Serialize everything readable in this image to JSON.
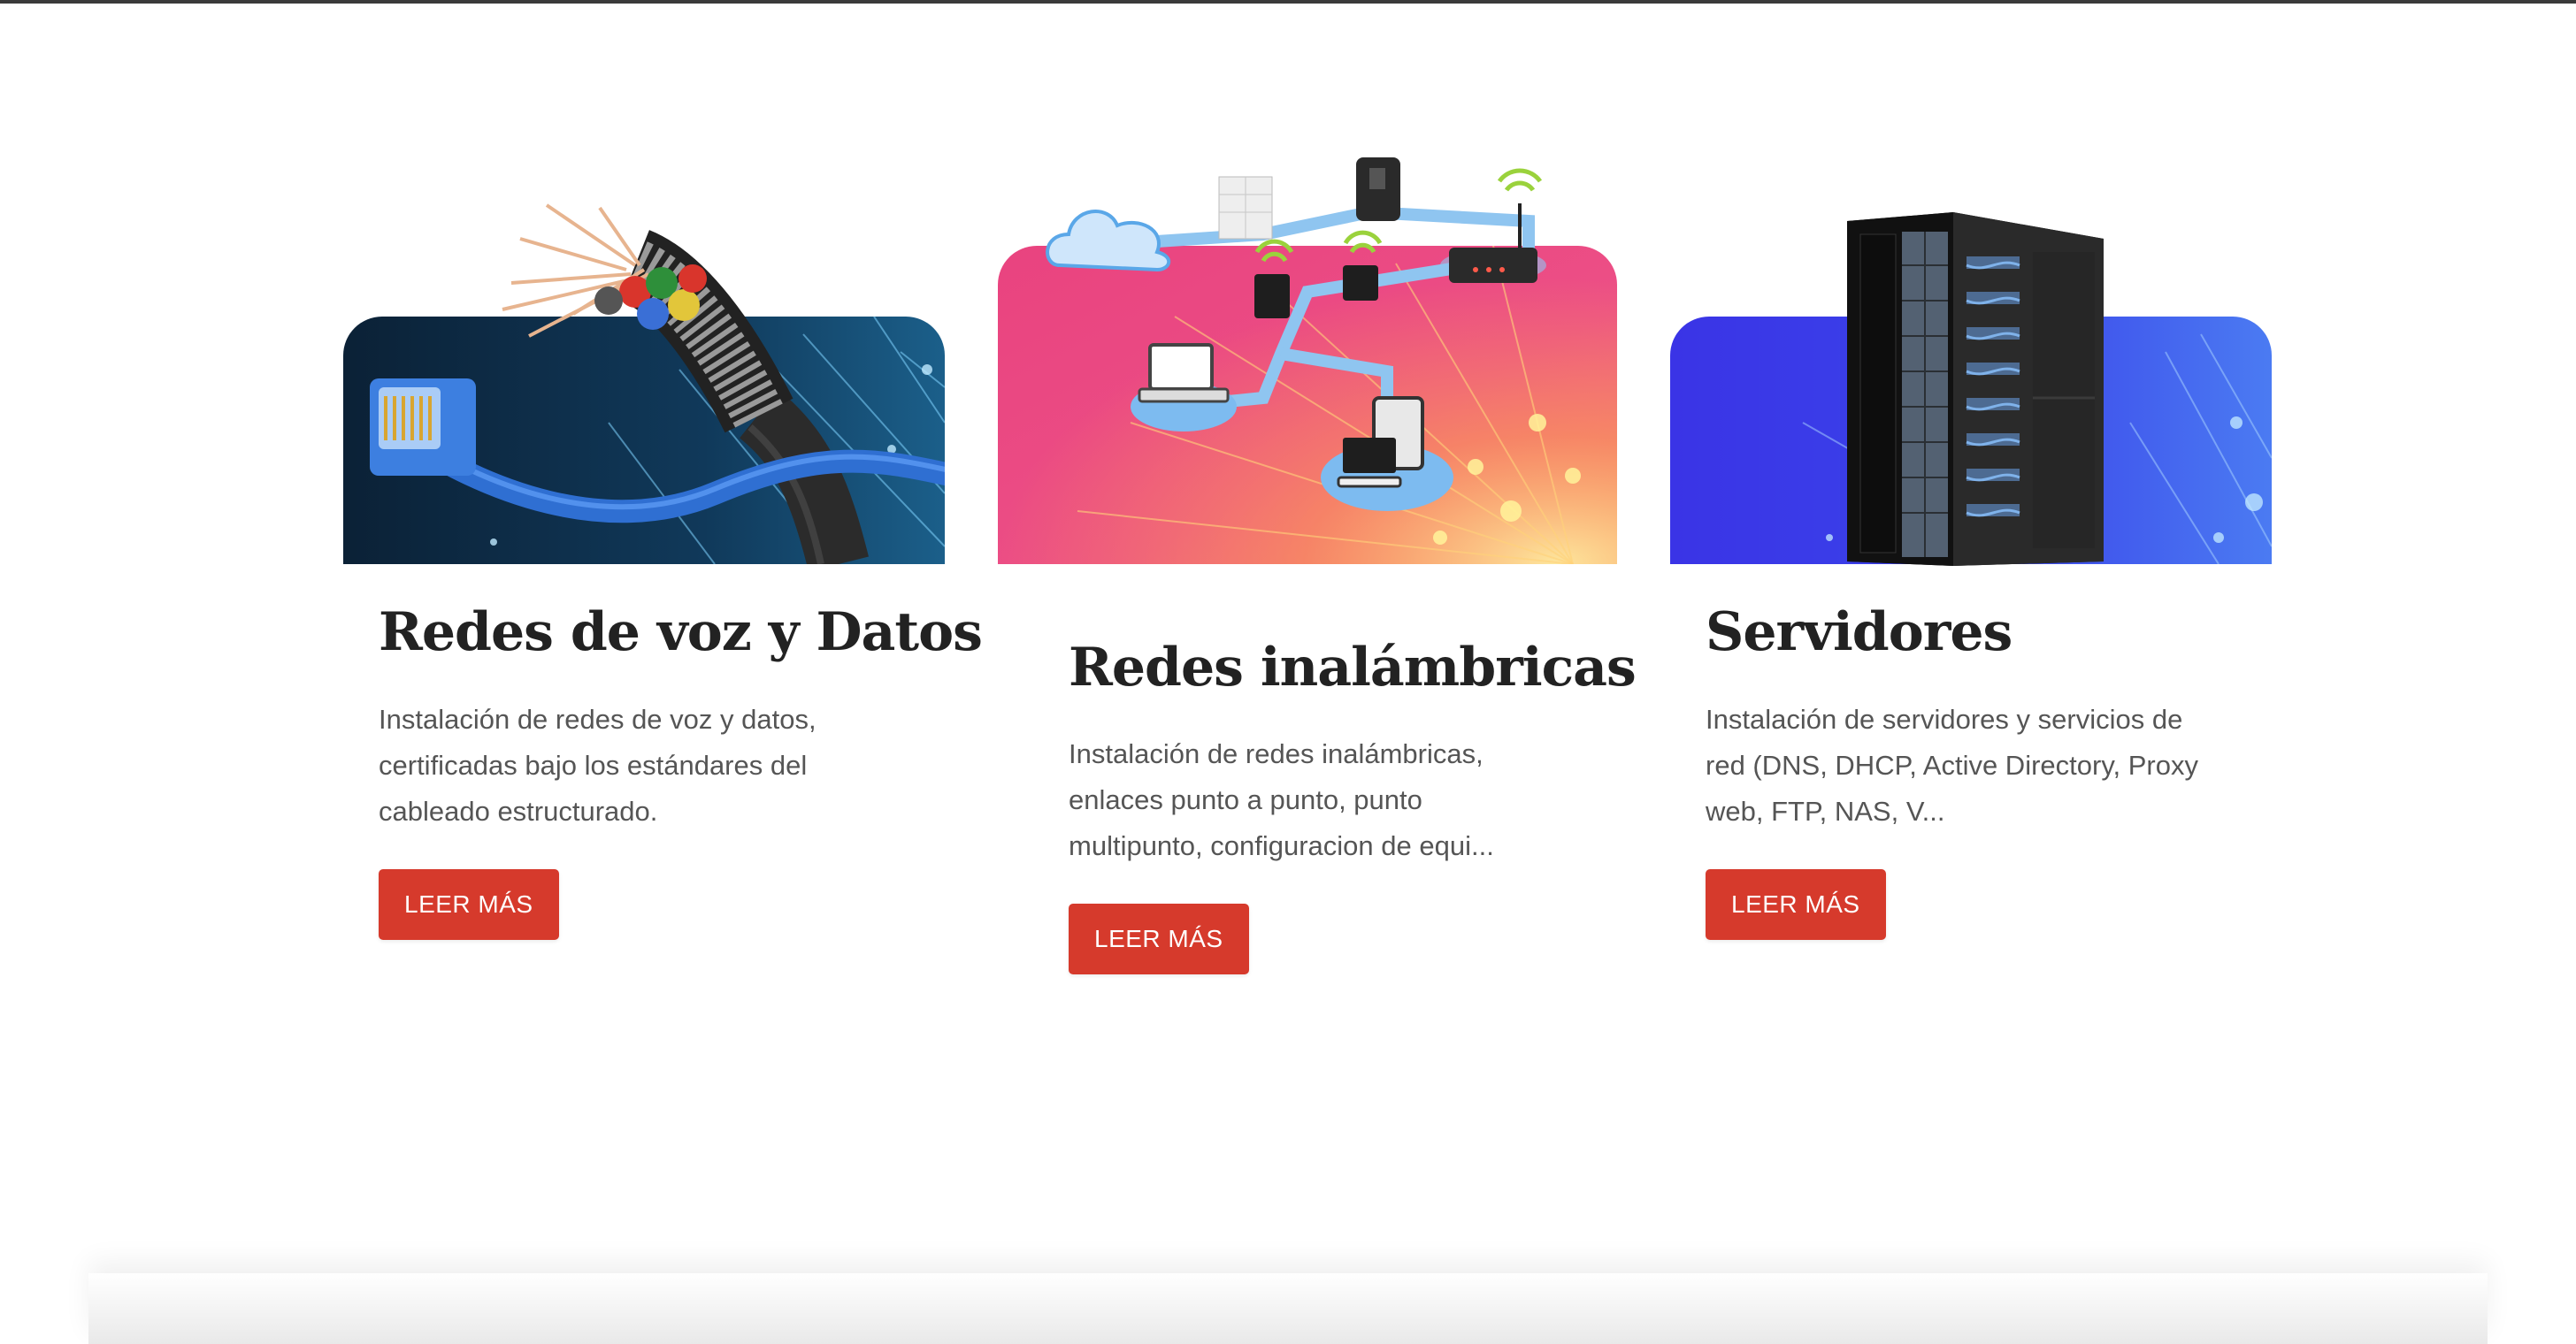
{
  "services": [
    {
      "title": "Redes de voz y Datos",
      "description": "Instalación de redes de voz y datos, certificadas bajo los estándares del cableado estructurado.",
      "button_label": "LEER MÁS",
      "image": "fiber-optic-cable-and-ethernet-plug",
      "accent": "#0d2a44"
    },
    {
      "title": "Redes inalámbricas",
      "description": "Instalación de redes inalámbricas, enlaces punto a punto, punto multipunto, configuracion de equi...",
      "button_label": "LEER MÁS",
      "image": "wireless-network-diagram",
      "accent": "#e94b86"
    },
    {
      "title": "Servidores",
      "description": "Instalación de servidores y servicios de red (DNS, DHCP, Active Directory, Proxy web, FTP, NAS, V...",
      "button_label": "LEER MÁS",
      "image": "server-rack",
      "accent": "#3a3ae8"
    }
  ],
  "colors": {
    "button": "#d63a2c",
    "heading": "#222222",
    "body_text": "#555555"
  }
}
